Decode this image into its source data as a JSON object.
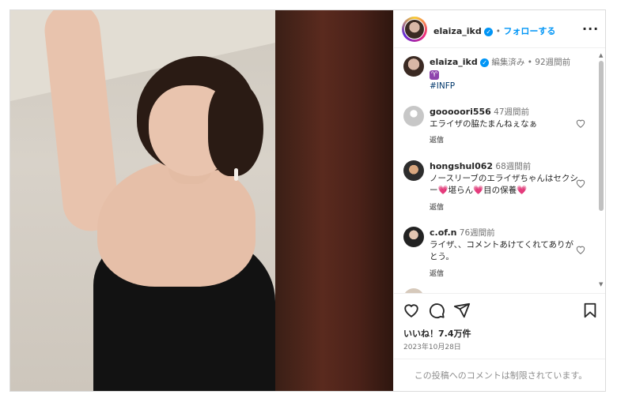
{
  "post_author": {
    "username": "elaiza_ikd",
    "follow_label": "フォローする",
    "separator": "•"
  },
  "caption": {
    "username": "elaiza_ikd",
    "edited": "編集済み",
    "time_ago": "92週間前",
    "line1": "♈",
    "hashtag": "#INFP"
  },
  "comments": [
    {
      "username": "gooooori556",
      "time_ago": "47週間前",
      "text": "エライザの脇たまんねぇなぁ",
      "reply_label": "返信"
    },
    {
      "username": "hongshul062",
      "time_ago": "68週間前",
      "text": "ノースリーブのエライザちゃんはセクシー💗堪らん💗目の保養💗",
      "reply_label": "返信"
    },
    {
      "username": "c.of.n",
      "time_ago": "76週間前",
      "text": "ライザ、、コメントあけてくれてありがとう。",
      "reply_label": "返信"
    }
  ],
  "likes_label": "いいね！7.4万件",
  "post_date": "2023年10月28日",
  "comments_disabled": "この投稿へのコメントは制限されています。",
  "icons": {
    "more": "more-options-icon",
    "like": "heart-icon",
    "comment": "comment-icon",
    "share": "share-icon",
    "save": "bookmark-icon"
  },
  "colors": {
    "link_blue": "#0095f6",
    "verified": "#0095f6",
    "heart_accent": "#e1306c"
  }
}
